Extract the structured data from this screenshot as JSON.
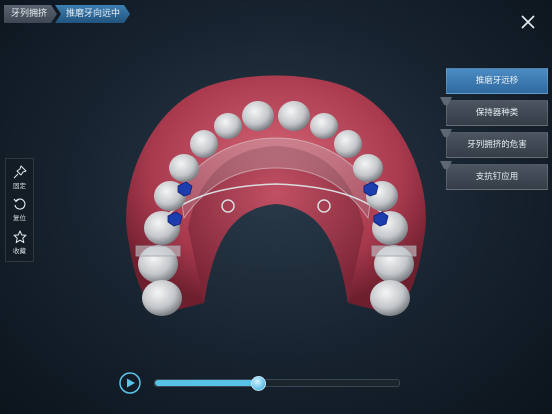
{
  "breadcrumb": {
    "items": [
      "牙列拥挤",
      "推磨牙向远中"
    ]
  },
  "close": {
    "icon": "close-icon"
  },
  "toolbar": {
    "items": [
      {
        "label": "固定",
        "icon": "pin-icon"
      },
      {
        "label": "复位",
        "icon": "reset-icon"
      },
      {
        "label": "收藏",
        "icon": "star-icon"
      }
    ]
  },
  "menu": {
    "items": [
      {
        "label": "推磨牙远移",
        "active": true
      },
      {
        "label": "保持器种类",
        "active": false
      },
      {
        "label": "牙列拥挤的危害",
        "active": false
      },
      {
        "label": "支抗钉应用",
        "active": false
      }
    ]
  },
  "player": {
    "progress": 0.42,
    "play_icon": "play-icon"
  },
  "colors": {
    "accent": "#3f7fb6",
    "progress": "#56c2e6",
    "gum": "#b8485a",
    "tooth": "#c9ccce",
    "bracket": "#1e3fb0"
  }
}
